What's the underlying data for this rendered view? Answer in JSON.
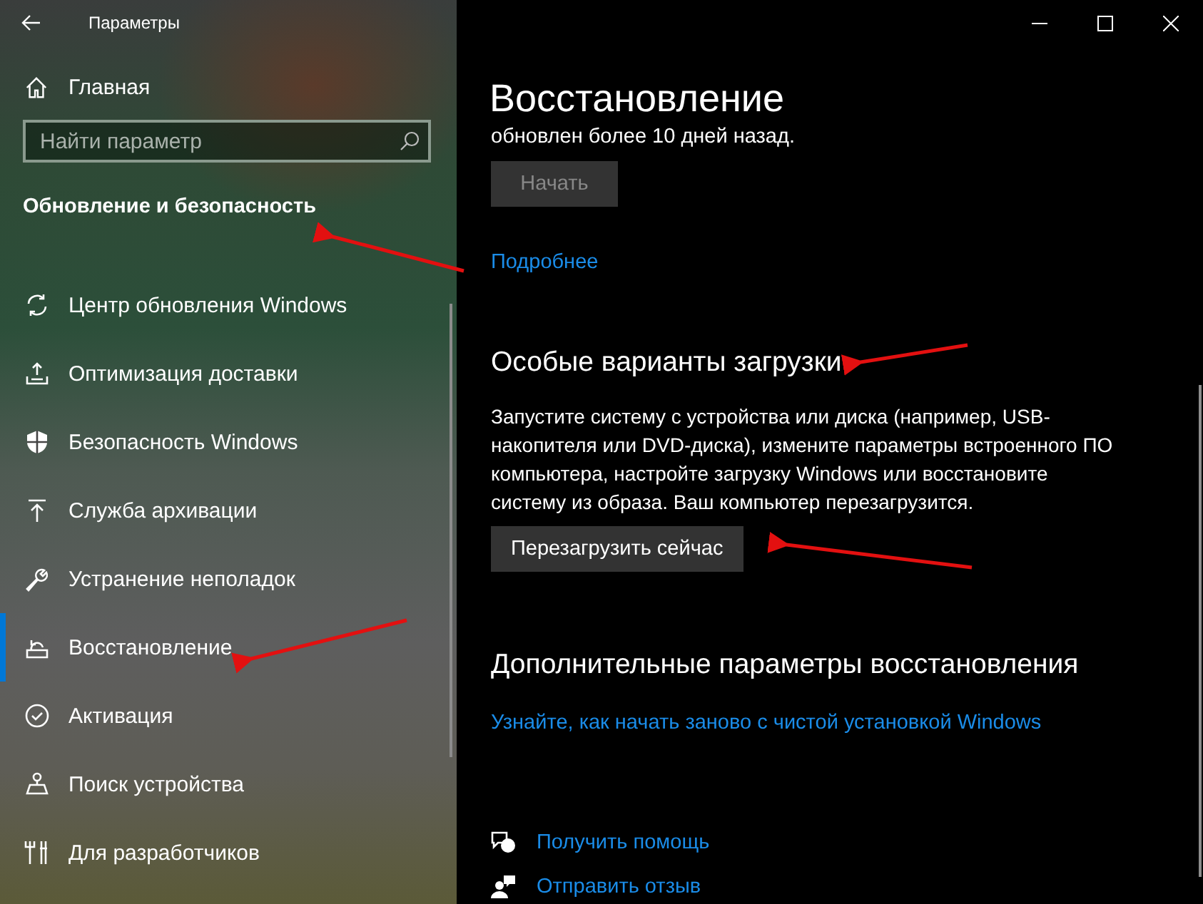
{
  "window": {
    "title": "Параметры"
  },
  "sidebar": {
    "home": "Главная",
    "search": {
      "placeholder": "Найти параметр"
    },
    "section": "Обновление и безопасность",
    "items": [
      {
        "label": "Центр обновления Windows",
        "selected": false
      },
      {
        "label": "Оптимизация доставки",
        "selected": false
      },
      {
        "label": "Безопасность Windows",
        "selected": false
      },
      {
        "label": "Служба архивации",
        "selected": false
      },
      {
        "label": "Устранение неполадок",
        "selected": false
      },
      {
        "label": "Восстановление",
        "selected": true
      },
      {
        "label": "Активация",
        "selected": false
      },
      {
        "label": "Поиск устройства",
        "selected": false
      },
      {
        "label": "Для разработчиков",
        "selected": false
      }
    ]
  },
  "page": {
    "title": "Восстановление",
    "status_text": "обновлен более 10 дней назад.",
    "start_button": {
      "label": "Начать",
      "disabled": true
    },
    "more_link": "Подробнее",
    "sections": [
      {
        "heading": "Особые варианты загрузки",
        "text": "Запустите систему с устройства или диска (например, USB-накопителя или DVD-диска), измените параметры встроенного ПО компьютера, настройте загрузку Windows или восстановите систему из образа. Ваш компьютер перезагрузится.",
        "button": {
          "label": "Перезагрузить сейчас",
          "disabled": false
        }
      },
      {
        "heading": "Дополнительные параметры восстановления",
        "link": "Узнайте, как начать заново с чистой установкой Windows"
      }
    ],
    "help_links": [
      "Получить помощь",
      "Отправить отзыв"
    ]
  }
}
